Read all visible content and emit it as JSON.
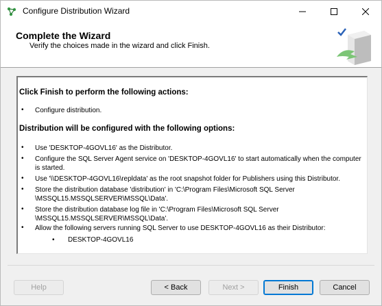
{
  "window": {
    "title": "Configure Distribution Wizard",
    "icon": "wizard-app-icon",
    "controls": [
      "minimize-icon",
      "maximize-icon",
      "close-icon"
    ]
  },
  "header": {
    "title": "Complete the Wizard",
    "subtitle": "Verify the choices made in the wizard and click Finish.",
    "graphic": "server-check-icon"
  },
  "summary": {
    "heading1": "Click Finish to perform the following actions:",
    "actions": [
      "Configure distribution."
    ],
    "heading2": "Distribution will be configured with the following options:",
    "options": [
      "Use 'DESKTOP-4GOVL16' as the Distributor.",
      "Configure the SQL Server Agent service on 'DESKTOP-4GOVL16' to start automatically when the computer is started.",
      "Use '\\\\DESKTOP-4GOVL16\\repldata' as the root snapshot folder for Publishers using this Distributor.",
      "Store the distribution database 'distribution' in 'C:\\Program Files\\Microsoft SQL Server \\MSSQL15.MSSQLSERVER\\MSSQL\\Data'.",
      "Store the distribution database log file in 'C:\\Program Files\\Microsoft SQL Server \\MSSQL15.MSSQLSERVER\\MSSQL\\Data'.",
      "Allow the following servers running SQL Server to use DESKTOP-4GOVL16 as their Distributor:"
    ],
    "servers": [
      "DESKTOP-4GOVL16"
    ],
    "bullet": "•"
  },
  "buttons": {
    "help": "Help",
    "back": "< Back",
    "next": "Next >",
    "finish": "Finish",
    "cancel": "Cancel"
  },
  "colors": {
    "accent": "#0078d4",
    "disabled_text": "#a0a0a0"
  }
}
